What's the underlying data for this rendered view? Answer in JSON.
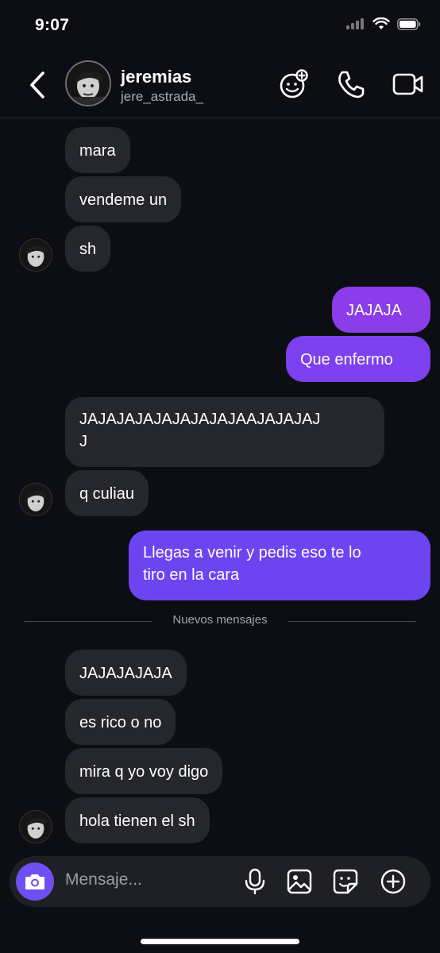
{
  "status_bar": {
    "time": "9:07"
  },
  "header": {
    "name": "jeremias",
    "username": "jere_astrada_"
  },
  "messages": [
    {
      "text": "mara"
    },
    {
      "text": "vendeme un"
    },
    {
      "text": "sh"
    },
    {
      "text": "JAJAJA"
    },
    {
      "text": "Que enfermo"
    },
    {
      "text": "JAJAJAJAJAJAJAJAJAAJAJAJAJ\nJ"
    },
    {
      "text": "q culiau"
    },
    {
      "text": "Llegas a venir y pedis eso te lo\ntiro en la cara"
    },
    {
      "text": "JAJAJAJAJA"
    },
    {
      "text": "es rico o no"
    },
    {
      "text": "mira q yo voy digo"
    },
    {
      "text": "hola tienen el sh"
    }
  ],
  "divider": {
    "label": "Nuevos mensajes"
  },
  "composer": {
    "placeholder": "Mensaje..."
  },
  "colors": {
    "incoming": "#25272c",
    "outgoing_purple": "#8a3de8",
    "outgoing_violet": "#6d45f0",
    "accent": "#6f4ef2"
  },
  "icons": [
    "back-chevron-icon",
    "effects-icon",
    "phone-icon",
    "video-icon",
    "camera-icon",
    "microphone-icon",
    "gallery-icon",
    "sticker-icon",
    "plus-icon"
  ]
}
